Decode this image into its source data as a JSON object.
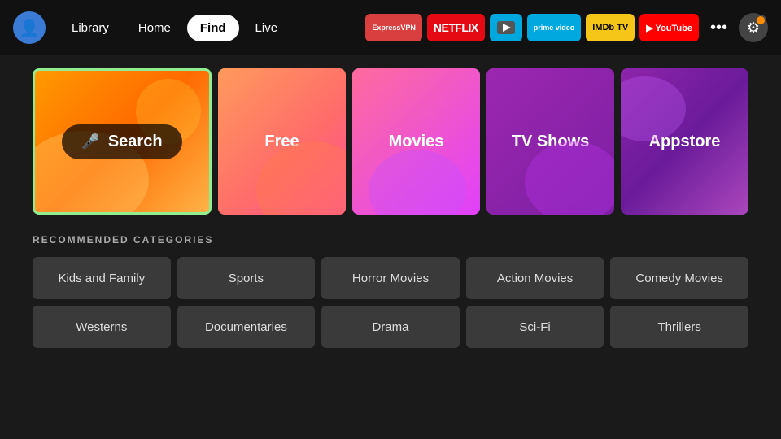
{
  "header": {
    "nav": {
      "items": [
        {
          "id": "library",
          "label": "Library",
          "active": false
        },
        {
          "id": "home",
          "label": "Home",
          "active": false
        },
        {
          "id": "find",
          "label": "Find",
          "active": true
        },
        {
          "id": "live",
          "label": "Live",
          "active": false
        }
      ]
    },
    "apps": [
      {
        "id": "expressvpn",
        "label": "ExpressVPN",
        "class": "expressvpn"
      },
      {
        "id": "netflix",
        "label": "NETFLIX",
        "class": "netflix"
      },
      {
        "id": "freevee",
        "label": "▶",
        "class": "freevee"
      },
      {
        "id": "prime",
        "label": "prime video",
        "class": "prime"
      },
      {
        "id": "imdb",
        "label": "IMDb TV",
        "class": "imdb"
      },
      {
        "id": "youtube",
        "label": "▶ YouTube",
        "class": "youtube"
      }
    ],
    "more_label": "•••",
    "settings_tooltip": "Settings"
  },
  "tiles": [
    {
      "id": "search",
      "label": "Search",
      "type": "search"
    },
    {
      "id": "free",
      "label": "Free",
      "type": "free"
    },
    {
      "id": "movies",
      "label": "Movies",
      "type": "movies"
    },
    {
      "id": "tvshows",
      "label": "TV Shows",
      "type": "tvshows"
    },
    {
      "id": "appstore",
      "label": "Appstore",
      "type": "appstore"
    }
  ],
  "recommended": {
    "section_title": "RECOMMENDED CATEGORIES",
    "row1": [
      {
        "id": "kids-family",
        "label": "Kids and Family"
      },
      {
        "id": "sports",
        "label": "Sports"
      },
      {
        "id": "horror-movies",
        "label": "Horror Movies"
      },
      {
        "id": "action-movies",
        "label": "Action Movies"
      },
      {
        "id": "comedy-movies",
        "label": "Comedy Movies"
      }
    ],
    "row2": [
      {
        "id": "westerns",
        "label": "Westerns"
      },
      {
        "id": "documentaries",
        "label": "Documentaries"
      },
      {
        "id": "drama",
        "label": "Drama"
      },
      {
        "id": "sci-fi",
        "label": "Sci-Fi"
      },
      {
        "id": "thrillers",
        "label": "Thrillers"
      }
    ]
  }
}
